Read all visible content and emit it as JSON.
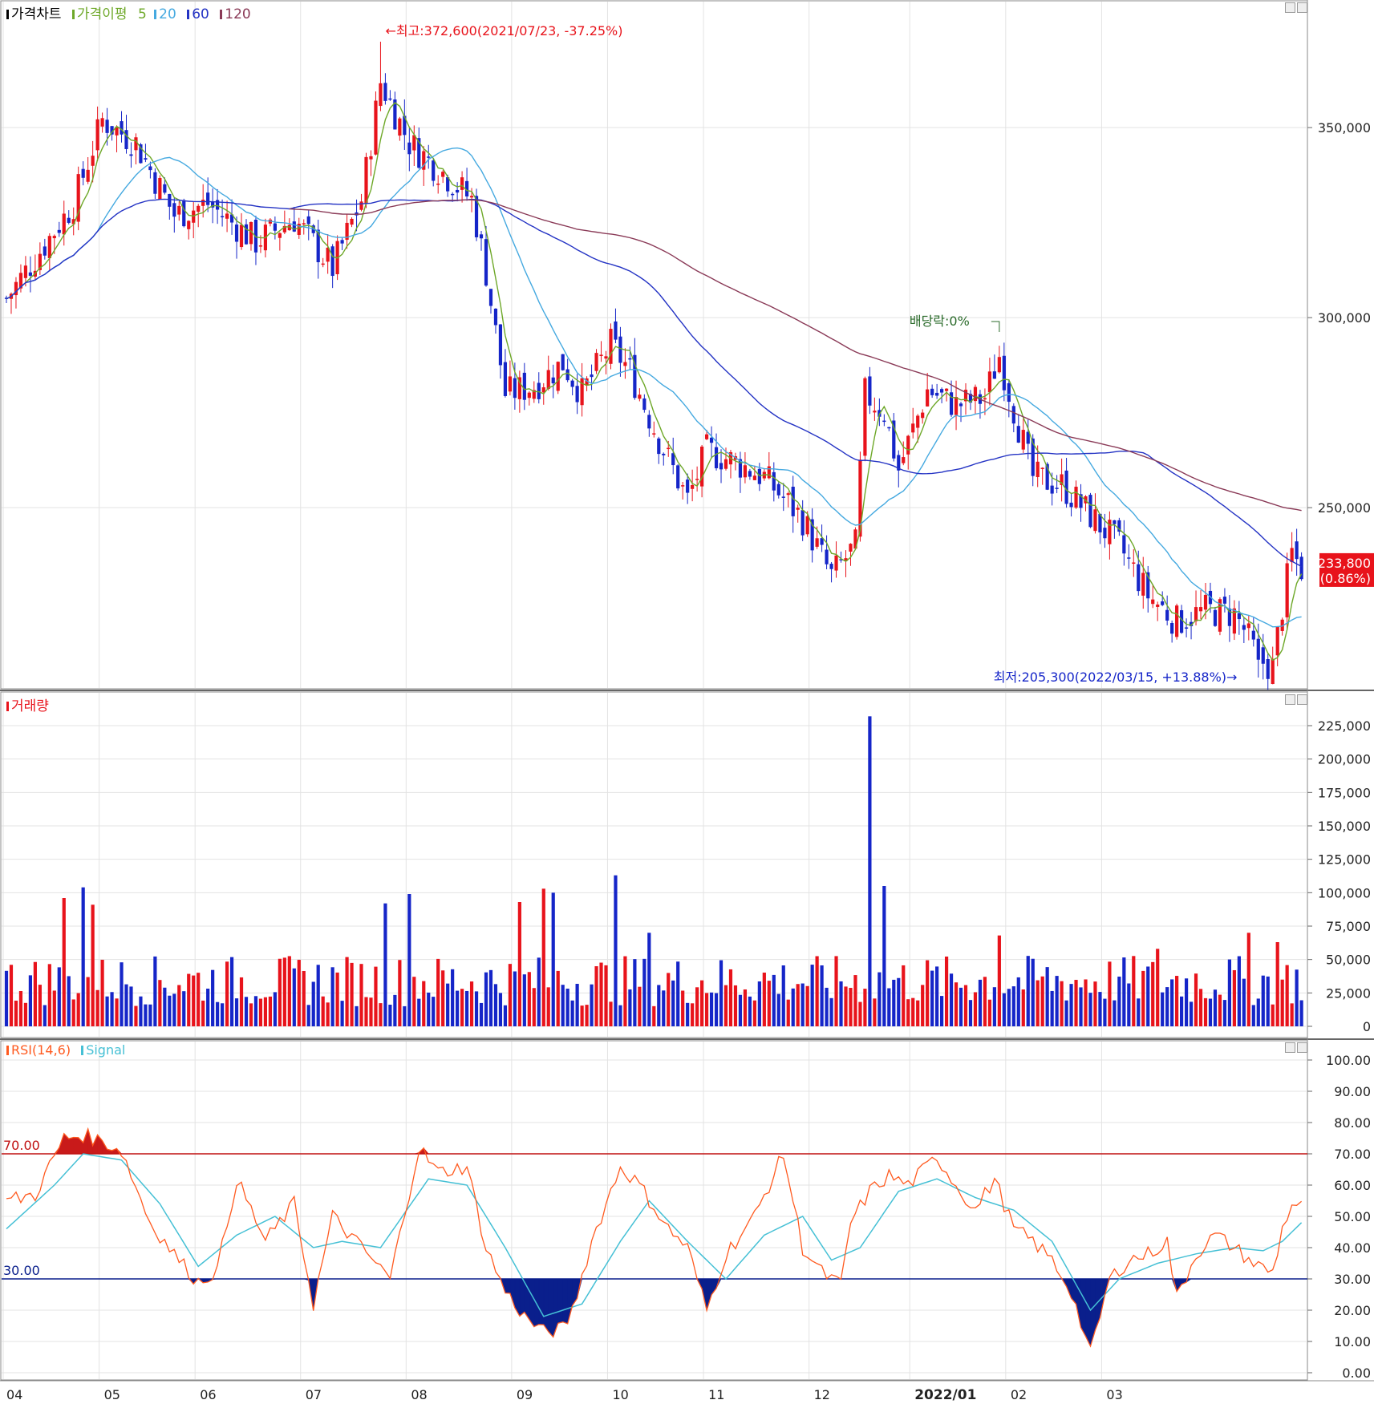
{
  "header": {
    "price_title": "가격차트",
    "ma_label": "가격이평",
    "ma_periods": [
      "5",
      "20",
      "60",
      "120"
    ],
    "volume_title": "거래량",
    "rsi_title": "RSI(14,6)",
    "signal_title": "Signal"
  },
  "colors": {
    "up": "#e8131b",
    "down": "#1525c8",
    "ma5": "#6ea829",
    "ma20": "#45a9e0",
    "ma60": "#2433c4",
    "ma120": "#8a3a57",
    "rsi": "#ff5a1f",
    "signal": "#45c0d5",
    "overbought": "#c91a1a",
    "oversold": "#0a1f8c",
    "grid": "#e3e3e3"
  },
  "annotations": {
    "high": "←최고:372,600(2021/07/23, -37.25%)",
    "low": "최저:205,300(2022/03/15, +13.88%)→",
    "dividend": "배당락:0%",
    "current_price": "233,800",
    "current_change": "(0.86%)"
  },
  "chart_data": [
    {
      "type": "candlestick",
      "title": "가격차트",
      "y_ticks": [
        "350,000",
        "300,000",
        "250,000"
      ],
      "x_ticks": [
        "04",
        "05",
        "06",
        "07",
        "08",
        "09",
        "10",
        "11",
        "12",
        "2022/01",
        "02",
        "03"
      ],
      "grid": true,
      "series_anchors": {
        "close": [
          [
            0,
            305000
          ],
          [
            14,
            330000
          ],
          [
            20,
            352000
          ],
          [
            27,
            346000
          ],
          [
            35,
            327000
          ],
          [
            42,
            330000
          ],
          [
            52,
            320000
          ],
          [
            60,
            326000
          ],
          [
            68,
            313000
          ],
          [
            74,
            331000
          ],
          [
            78,
            362000
          ],
          [
            84,
            346000
          ],
          [
            92,
            337000
          ],
          [
            97,
            331000
          ],
          [
            100,
            312000
          ],
          [
            104,
            280000
          ],
          [
            110,
            282000
          ],
          [
            116,
            288000
          ],
          [
            120,
            280000
          ],
          [
            126,
            293000
          ],
          [
            130,
            286000
          ],
          [
            136,
            268000
          ],
          [
            142,
            252000
          ],
          [
            146,
            265000
          ],
          [
            152,
            262000
          ],
          [
            158,
            258000
          ],
          [
            166,
            247000
          ],
          [
            172,
            232000
          ],
          [
            177,
            240000
          ],
          [
            179,
            280000
          ],
          [
            183,
            275000
          ],
          [
            186,
            260000
          ],
          [
            192,
            281000
          ],
          [
            198,
            277000
          ],
          [
            204,
            279000
          ],
          [
            207,
            290000
          ],
          [
            210,
            276000
          ],
          [
            214,
            258000
          ],
          [
            220,
            256000
          ],
          [
            226,
            248000
          ],
          [
            232,
            240000
          ],
          [
            238,
            227000
          ],
          [
            244,
            220000
          ],
          [
            250,
            223000
          ],
          [
            256,
            222000
          ],
          [
            258,
            218000
          ],
          [
            261,
            210000
          ],
          [
            264,
            208000
          ],
          [
            266,
            224000
          ],
          [
            268,
            238000
          ],
          [
            270,
            234000
          ]
        ]
      }
    },
    {
      "type": "bar",
      "title": "거래량",
      "y_ticks": [
        "225,000",
        "200,000",
        "175,000",
        "150,000",
        "125,000",
        "100,000",
        "75,000",
        "50,000",
        "25,000",
        "0"
      ],
      "ylim": [
        0,
        240000
      ],
      "spikes": [
        [
          12,
          96000
        ],
        [
          16,
          104000
        ],
        [
          18,
          91000
        ],
        [
          79,
          92000
        ],
        [
          84,
          99000
        ],
        [
          107,
          93000
        ],
        [
          112,
          103000
        ],
        [
          114,
          100000
        ],
        [
          127,
          113000
        ],
        [
          134,
          70000
        ],
        [
          180,
          232000
        ],
        [
          183,
          105000
        ],
        [
          207,
          68000
        ],
        [
          240,
          58000
        ],
        [
          259,
          70000
        ],
        [
          265,
          63000
        ]
      ]
    },
    {
      "type": "line",
      "title": "RSI(14,6)",
      "series": [
        {
          "name": "RSI(14,6)"
        },
        {
          "name": "Signal"
        }
      ],
      "y_ticks": [
        "100.00",
        "90.00",
        "80.00",
        "70.00",
        "60.00",
        "50.00",
        "40.00",
        "30.00",
        "20.00",
        "10.00",
        "0.00"
      ],
      "ylim": [
        0,
        100
      ],
      "levels": [
        "70.00",
        "30.00"
      ],
      "rsi_anchors": [
        [
          0,
          55
        ],
        [
          6,
          57
        ],
        [
          12,
          75
        ],
        [
          16,
          76
        ],
        [
          20,
          74
        ],
        [
          24,
          71
        ],
        [
          30,
          48
        ],
        [
          36,
          36
        ],
        [
          40,
          29
        ],
        [
          44,
          33
        ],
        [
          48,
          62
        ],
        [
          54,
          42
        ],
        [
          60,
          54
        ],
        [
          64,
          22
        ],
        [
          68,
          50
        ],
        [
          74,
          40
        ],
        [
          80,
          30
        ],
        [
          86,
          72
        ],
        [
          90,
          64
        ],
        [
          96,
          66
        ],
        [
          100,
          40
        ],
        [
          104,
          26
        ],
        [
          108,
          18
        ],
        [
          112,
          13
        ],
        [
          116,
          14
        ],
        [
          118,
          20
        ],
        [
          122,
          42
        ],
        [
          128,
          66
        ],
        [
          132,
          60
        ],
        [
          138,
          46
        ],
        [
          142,
          40
        ],
        [
          146,
          20
        ],
        [
          150,
          38
        ],
        [
          156,
          50
        ],
        [
          162,
          70
        ],
        [
          166,
          40
        ],
        [
          170,
          32
        ],
        [
          174,
          28
        ],
        [
          176,
          48
        ],
        [
          180,
          58
        ],
        [
          184,
          63
        ],
        [
          188,
          60
        ],
        [
          194,
          69
        ],
        [
          198,
          60
        ],
        [
          202,
          52
        ],
        [
          206,
          62
        ],
        [
          210,
          46
        ],
        [
          214,
          42
        ],
        [
          218,
          36
        ],
        [
          222,
          26
        ],
        [
          226,
          6
        ],
        [
          230,
          30
        ],
        [
          234,
          36
        ],
        [
          238,
          38
        ],
        [
          242,
          42
        ],
        [
          244,
          24
        ],
        [
          248,
          38
        ],
        [
          252,
          44
        ],
        [
          256,
          40
        ],
        [
          260,
          35
        ],
        [
          264,
          32
        ],
        [
          266,
          46
        ],
        [
          268,
          54
        ],
        [
          270,
          53
        ]
      ],
      "signal_anchors": [
        [
          0,
          46
        ],
        [
          10,
          60
        ],
        [
          16,
          70
        ],
        [
          24,
          68
        ],
        [
          32,
          54
        ],
        [
          40,
          34
        ],
        [
          48,
          44
        ],
        [
          56,
          50
        ],
        [
          64,
          40
        ],
        [
          70,
          42
        ],
        [
          78,
          40
        ],
        [
          88,
          62
        ],
        [
          96,
          60
        ],
        [
          104,
          40
        ],
        [
          112,
          18
        ],
        [
          120,
          22
        ],
        [
          128,
          42
        ],
        [
          134,
          55
        ],
        [
          142,
          42
        ],
        [
          150,
          30
        ],
        [
          158,
          44
        ],
        [
          166,
          50
        ],
        [
          172,
          36
        ],
        [
          178,
          40
        ],
        [
          186,
          58
        ],
        [
          194,
          62
        ],
        [
          202,
          56
        ],
        [
          210,
          52
        ],
        [
          218,
          42
        ],
        [
          226,
          20
        ],
        [
          232,
          30
        ],
        [
          240,
          35
        ],
        [
          248,
          38
        ],
        [
          256,
          40
        ],
        [
          262,
          39
        ],
        [
          266,
          42
        ],
        [
          270,
          48
        ]
      ]
    }
  ]
}
